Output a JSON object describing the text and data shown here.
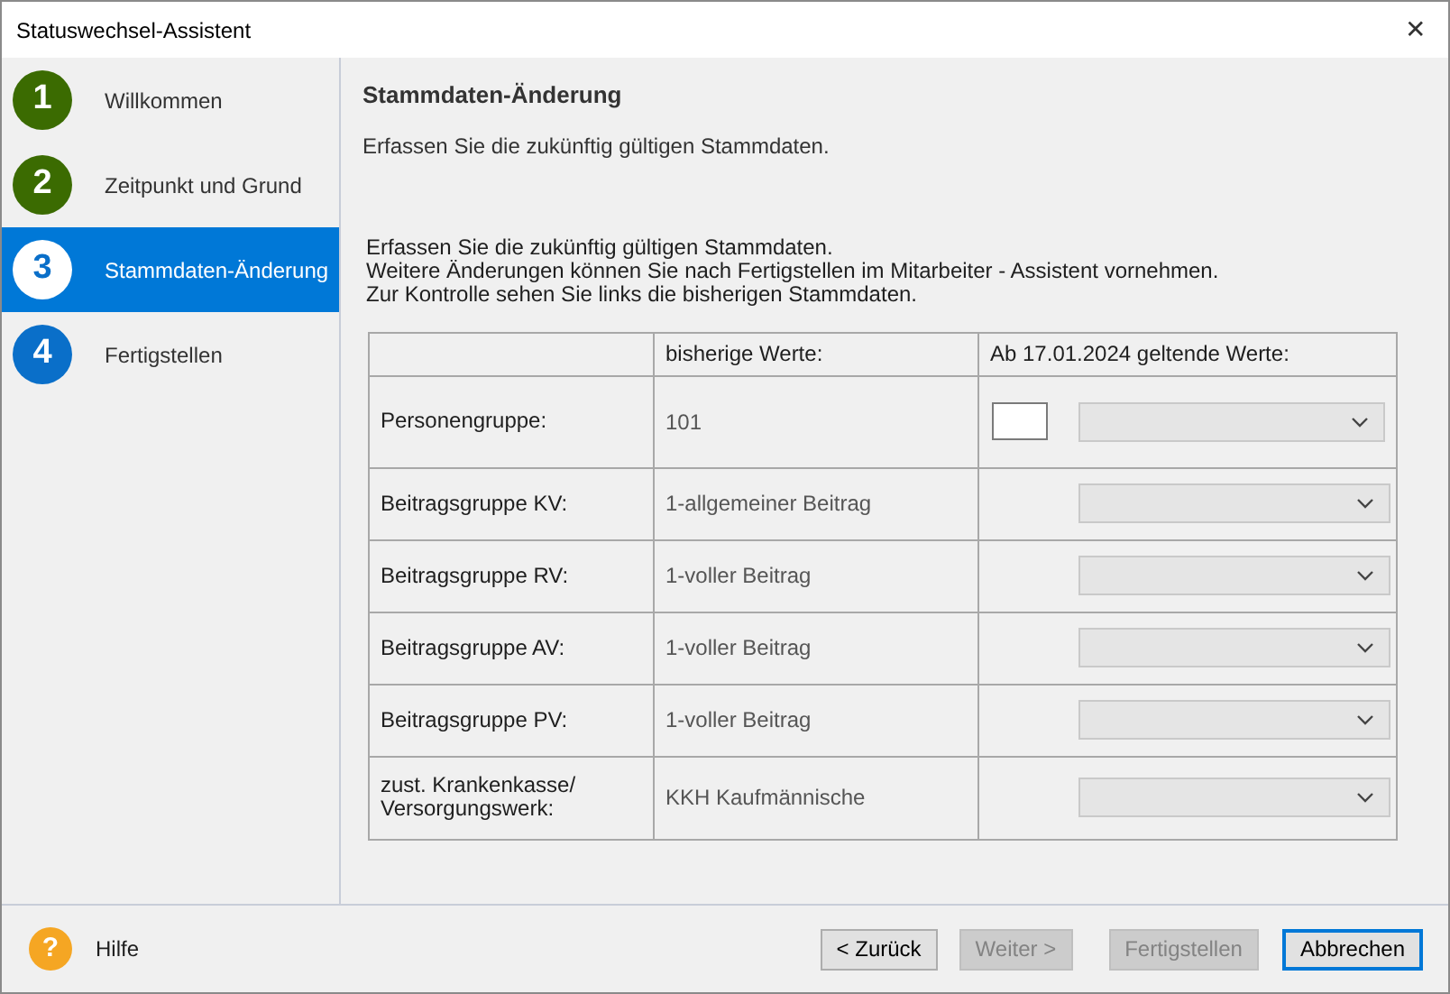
{
  "window": {
    "title": "Statuswechsel-Assistent",
    "close": "✕"
  },
  "steps": [
    {
      "number": "1",
      "label": "Willkommen",
      "selected": false,
      "done": true
    },
    {
      "number": "2",
      "label": "Zeitpunkt und Grund",
      "selected": false,
      "done": true
    },
    {
      "number": "3",
      "label": "Stammdaten-Änderung",
      "selected": true,
      "done": false
    },
    {
      "number": "4",
      "label": "Fertigstellen",
      "selected": false,
      "done": false
    }
  ],
  "heading": "Stammdaten-Änderung",
  "subtitle": "Erfassen Sie die zukünftig gültigen Stammdaten.",
  "description": [
    "Erfassen Sie die zukünftig gültigen Stammdaten.",
    "Weitere Änderungen können Sie nach Fertigstellen im Mitarbeiter - Assistent vornehmen.",
    "Zur Kontrolle sehen Sie links die bisherigen Stammdaten."
  ],
  "table": {
    "header": {
      "previous": "bisherige Werte:",
      "new": "Ab 17.01.2024 geltende Werte:"
    },
    "rows": [
      {
        "label": "Personengruppe:",
        "previous": "101",
        "kind": "input_select"
      },
      {
        "label": "Beitragsgruppe KV:",
        "previous": "1-allgemeiner Beitrag",
        "kind": "select"
      },
      {
        "label": "Beitragsgruppe RV:",
        "previous": "1-voller Beitrag",
        "kind": "select"
      },
      {
        "label": "Beitragsgruppe AV:",
        "previous": "1-voller Beitrag",
        "kind": "select"
      },
      {
        "label": "Beitragsgruppe PV:",
        "previous": "1-voller Beitrag",
        "kind": "select"
      },
      {
        "label": "zust. Krankenkasse/\nVersorgungswerk:",
        "previous": "KKH Kaufmännische",
        "kind": "select"
      }
    ]
  },
  "help": {
    "icon": "?",
    "label": "Hilfe"
  },
  "buttons": [
    {
      "label": "< Zurück",
      "disabled": false,
      "default": false
    },
    {
      "label": "Weiter >",
      "disabled": true,
      "default": false
    },
    {
      "label": "Fertigstellen",
      "disabled": true,
      "default": false
    },
    {
      "label": "Abbrechen",
      "disabled": false,
      "default": true
    }
  ]
}
